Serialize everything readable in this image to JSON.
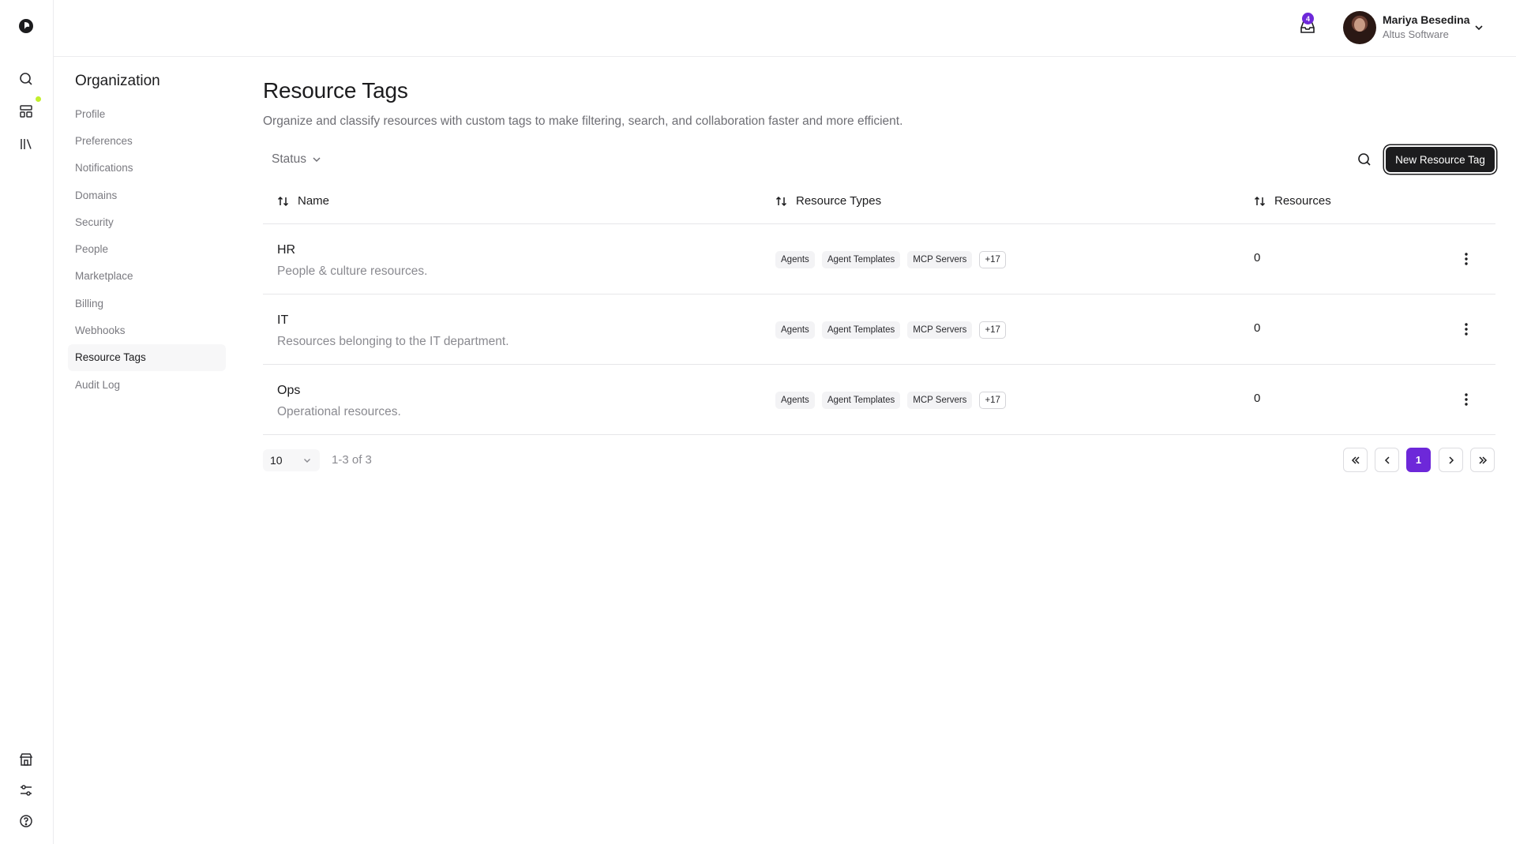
{
  "header": {
    "notifications_count": "4",
    "user": {
      "name": "Mariya Besedina",
      "org": "Altus Software"
    }
  },
  "settings_nav": {
    "title": "Organization",
    "items": [
      {
        "label": "Profile"
      },
      {
        "label": "Preferences"
      },
      {
        "label": "Notifications"
      },
      {
        "label": "Domains"
      },
      {
        "label": "Security"
      },
      {
        "label": "People"
      },
      {
        "label": "Marketplace"
      },
      {
        "label": "Billing"
      },
      {
        "label": "Webhooks"
      },
      {
        "label": "Resource Tags",
        "active": true
      },
      {
        "label": "Audit Log"
      }
    ]
  },
  "main": {
    "title": "Resource Tags",
    "subtitle": "Organize and classify resources with custom tags to make filtering, search, and collaboration faster and more efficient.",
    "filter_label": "Status",
    "new_button_label": "New Resource Tag"
  },
  "table": {
    "columns": [
      {
        "label": "Name"
      },
      {
        "label": "Resource Types"
      },
      {
        "label": "Resources"
      }
    ],
    "rows": [
      {
        "name": "HR",
        "description": "People & culture resources.",
        "types": [
          "Agents",
          "Agent Templates",
          "MCP Servers"
        ],
        "more": "+17",
        "resources": "0"
      },
      {
        "name": "IT",
        "description": "Resources belonging to the IT department.",
        "types": [
          "Agents",
          "Agent Templates",
          "MCP Servers"
        ],
        "more": "+17",
        "resources": "0"
      },
      {
        "name": "Ops",
        "description": "Operational resources.",
        "types": [
          "Agents",
          "Agent Templates",
          "MCP Servers"
        ],
        "more": "+17",
        "resources": "0"
      }
    ]
  },
  "pagination": {
    "page_size": "10",
    "range_text": "1-3 of 3",
    "current_page": "1"
  },
  "icons": {
    "rail_top": [
      "logo-icon",
      "search-icon",
      "dashboard-icon",
      "library-icon"
    ],
    "rail_bottom": [
      "store-icon",
      "settings-sliders-icon",
      "help-icon"
    ]
  },
  "colors": {
    "accent": "#6d28d9",
    "primary_button": "#1c1c1e",
    "status_dot": "#c3ef2c"
  }
}
